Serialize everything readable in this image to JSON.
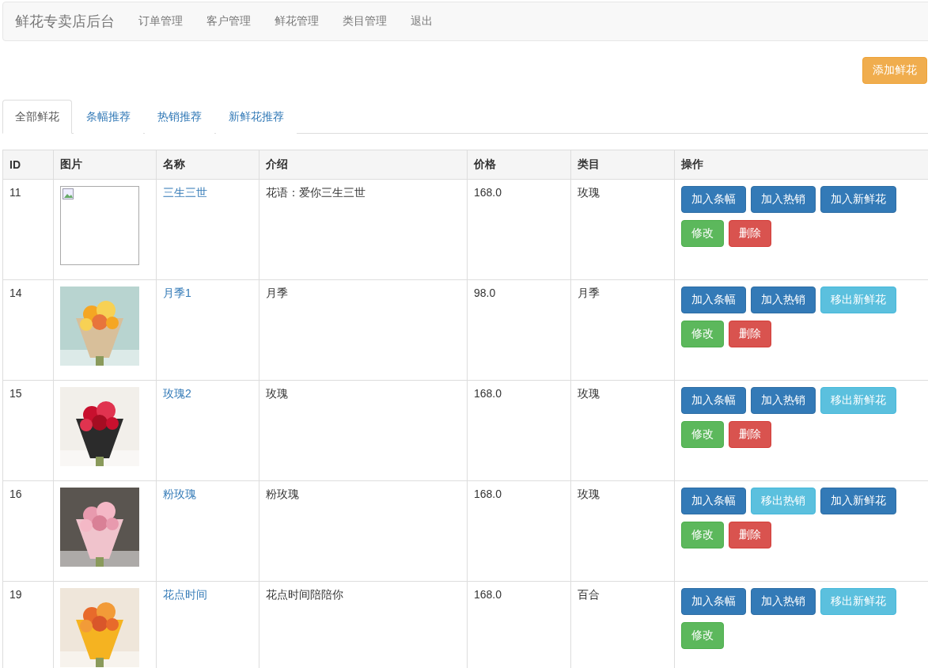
{
  "navbar": {
    "brand": "鲜花专卖店后台",
    "items": [
      "订单管理",
      "客户管理",
      "鲜花管理",
      "类目管理",
      "退出"
    ]
  },
  "add_button": "添加鲜花",
  "tabs": [
    {
      "label": "全部鲜花",
      "selected": true
    },
    {
      "label": "条幅推荐",
      "selected": false
    },
    {
      "label": "热销推荐",
      "selected": false
    },
    {
      "label": "新鲜花推荐",
      "selected": false
    }
  ],
  "table": {
    "columns": [
      "ID",
      "图片",
      "名称",
      "介绍",
      "价格",
      "类目",
      "操作"
    ],
    "rows": [
      {
        "id": "11",
        "image": {
          "kind": "broken"
        },
        "name": "三生三世",
        "intro": "花语：爱你三生三世",
        "price": "168.0",
        "category": "玫瑰",
        "actions": [
          {
            "label": "加入条幅",
            "kind": "add"
          },
          {
            "label": "加入热销",
            "kind": "add"
          },
          {
            "label": "加入新鲜花",
            "kind": "add"
          },
          {
            "label": "修改",
            "kind": "edit"
          },
          {
            "label": "删除",
            "kind": "delete"
          }
        ]
      },
      {
        "id": "14",
        "image": {
          "kind": "picture"
        },
        "name": "月季1",
        "intro": "月季",
        "price": "98.0",
        "category": "月季",
        "actions": [
          {
            "label": "加入条幅",
            "kind": "add"
          },
          {
            "label": "加入热销",
            "kind": "add"
          },
          {
            "label": "移出新鲜花",
            "kind": "remove"
          },
          {
            "label": "修改",
            "kind": "edit"
          },
          {
            "label": "删除",
            "kind": "delete"
          }
        ]
      },
      {
        "id": "15",
        "image": {
          "kind": "picture"
        },
        "name": "玫瑰2",
        "intro": "玫瑰",
        "price": "168.0",
        "category": "玫瑰",
        "actions": [
          {
            "label": "加入条幅",
            "kind": "add"
          },
          {
            "label": "加入热销",
            "kind": "add"
          },
          {
            "label": "移出新鲜花",
            "kind": "remove"
          },
          {
            "label": "修改",
            "kind": "edit"
          },
          {
            "label": "删除",
            "kind": "delete"
          }
        ]
      },
      {
        "id": "16",
        "image": {
          "kind": "picture"
        },
        "name": "粉玫瑰",
        "intro": "粉玫瑰",
        "price": "168.0",
        "category": "玫瑰",
        "actions": [
          {
            "label": "加入条幅",
            "kind": "add"
          },
          {
            "label": "移出热销",
            "kind": "remove"
          },
          {
            "label": "加入新鲜花",
            "kind": "add"
          },
          {
            "label": "修改",
            "kind": "edit"
          },
          {
            "label": "删除",
            "kind": "delete"
          }
        ]
      },
      {
        "id": "19",
        "image": {
          "kind": "picture"
        },
        "name": "花点时间",
        "intro": "花点时间陪陪你",
        "price": "168.0",
        "category": "百合",
        "actions": [
          {
            "label": "加入条幅",
            "kind": "add"
          },
          {
            "label": "加入热销",
            "kind": "add"
          },
          {
            "label": "移出新鲜花",
            "kind": "remove"
          },
          {
            "label": "修改",
            "kind": "edit"
          }
        ]
      }
    ]
  }
}
